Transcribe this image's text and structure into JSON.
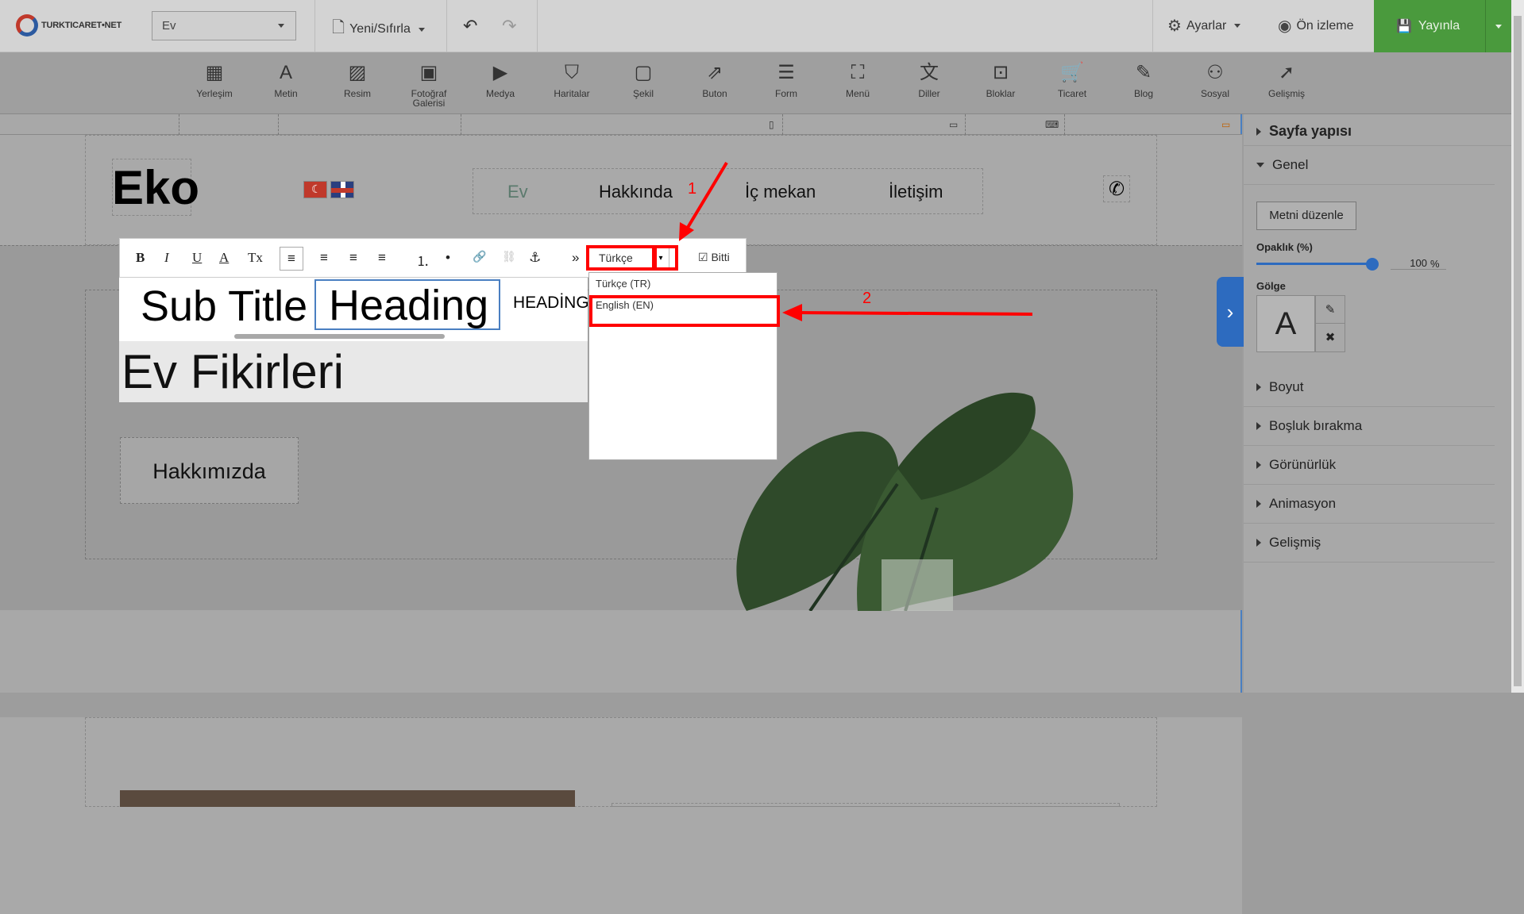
{
  "topbar": {
    "logo_text": "TURKTICARET•NET",
    "page_select_value": "Ev",
    "new_reset_label": "Yeni/Sıfırla",
    "settings_label": "Ayarlar",
    "preview_label": "Ön izleme",
    "publish_label": "Yayınla"
  },
  "tools": [
    {
      "label": "Yerleşim",
      "icon": "layout-icon",
      "glyph": "▦"
    },
    {
      "label": "Metin",
      "icon": "text-icon",
      "glyph": "A"
    },
    {
      "label": "Resim",
      "icon": "image-icon",
      "glyph": "▨"
    },
    {
      "label": "Fotoğraf Galerisi",
      "icon": "gallery-icon",
      "glyph": "▣"
    },
    {
      "label": "Medya",
      "icon": "media-icon",
      "glyph": "▶"
    },
    {
      "label": "Haritalar",
      "icon": "map-icon",
      "glyph": "⛉"
    },
    {
      "label": "Şekil",
      "icon": "shape-icon",
      "glyph": "▢"
    },
    {
      "label": "Buton",
      "icon": "button-icon",
      "glyph": "⇗"
    },
    {
      "label": "Form",
      "icon": "form-icon",
      "glyph": "☰"
    },
    {
      "label": "Menü",
      "icon": "menu-icon",
      "glyph": "⛶"
    },
    {
      "label": "Diller",
      "icon": "language-icon",
      "glyph": "文"
    },
    {
      "label": "Bloklar",
      "icon": "blocks-icon",
      "glyph": "⊡"
    },
    {
      "label": "Ticaret",
      "icon": "cart-icon",
      "glyph": "🛒"
    },
    {
      "label": "Blog",
      "icon": "blog-icon",
      "glyph": "✎"
    },
    {
      "label": "Sosyal",
      "icon": "social-icon",
      "glyph": "⚇"
    },
    {
      "label": "Gelişmiş",
      "icon": "rocket-icon",
      "glyph": "➚"
    }
  ],
  "site": {
    "brand": "Eko",
    "nav": [
      "Ev",
      "Hakkında",
      "İç mekan",
      "İletişim"
    ],
    "about_button": "Hakkımızda"
  },
  "editor": {
    "sub_title": "Sub Title",
    "heading": "Heading",
    "heading_caps": "HEADİNG",
    "hero_title": "Ev Fikirleri",
    "language_value": "Türkçe",
    "done_label": "Bitti",
    "buttons": [
      "B",
      "I",
      "U",
      "A",
      "Tx",
      "≡",
      "≡",
      "≡",
      "≡",
      "⒈",
      "•",
      "🔗",
      "⛓",
      "⚓",
      "»"
    ]
  },
  "dropdown": {
    "items": [
      "Türkçe (TR)",
      "English (EN)"
    ]
  },
  "annotations": {
    "step1": "1",
    "step2": "2",
    "color": "#ff0000"
  },
  "panel": {
    "page_structure": "Sayfa yapısı",
    "general": "Genel",
    "edit_text": "Metni düzenle",
    "opacity_label": "Opaklık (%)",
    "opacity_value": "100",
    "opacity_unit": "%",
    "shadow_label": "Gölge",
    "shadow_preview": "A",
    "sections": [
      "Boyut",
      "Boşluk bırakma",
      "Görünürlük",
      "Animasyon",
      "Gelişmiş"
    ]
  }
}
